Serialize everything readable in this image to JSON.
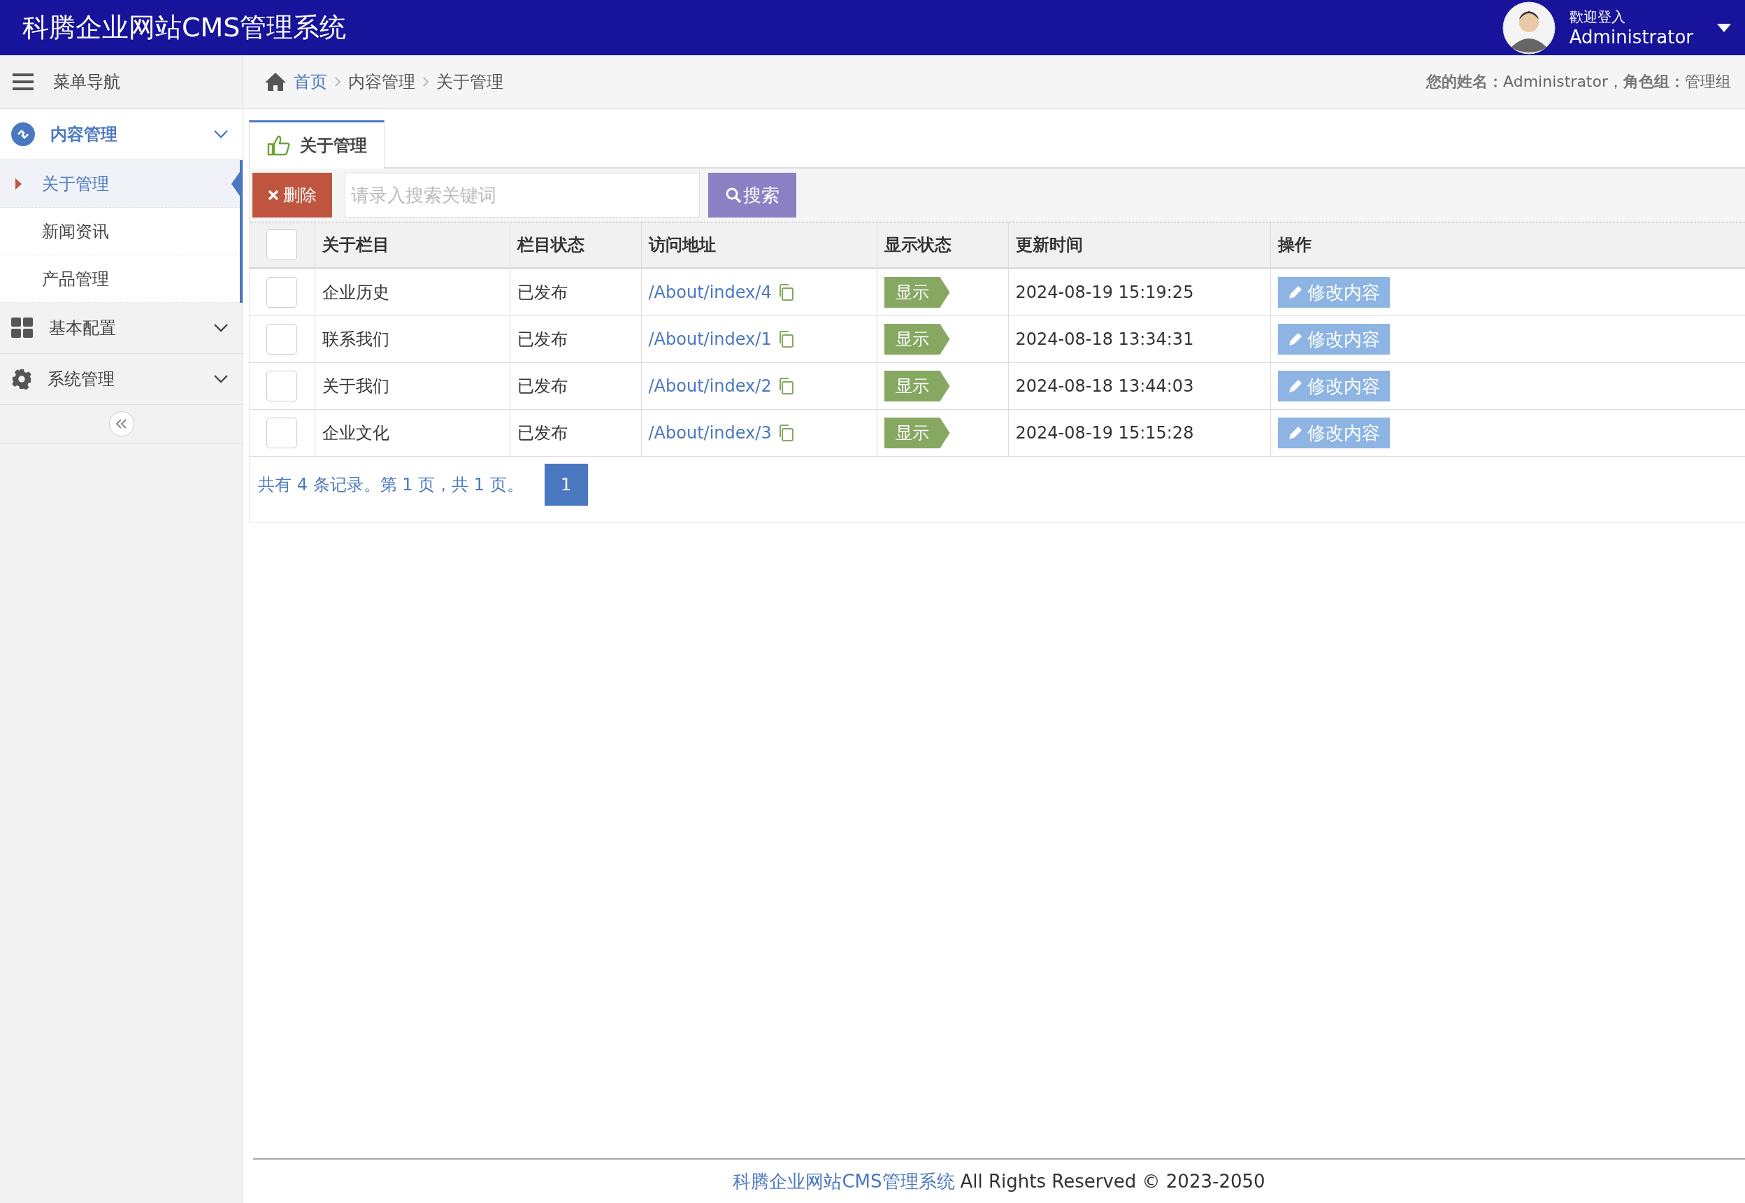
{
  "header": {
    "title": "科腾企业网站CMS管理系统",
    "user": {
      "greeting": "歡迎登入",
      "name": "Administrator"
    }
  },
  "sidebar": {
    "heading": "菜单导航",
    "groups": [
      {
        "label": "内容管理",
        "expanded": true,
        "children": [
          {
            "label": "关于管理",
            "selected": true
          },
          {
            "label": "新闻资讯",
            "selected": false
          },
          {
            "label": "产品管理",
            "selected": false
          }
        ]
      },
      {
        "label": "基本配置",
        "expanded": false
      },
      {
        "label": "系统管理",
        "expanded": false
      }
    ]
  },
  "breadcrumb": {
    "items": [
      "首页",
      "内容管理",
      "关于管理"
    ],
    "user_info": "**您的姓名：**Administrator，**角色组：**管理组"
  },
  "tab": {
    "label": "关于管理"
  },
  "toolbar": {
    "delete_button": "删除",
    "search": {
      "placeholder": "请录入搜索关键词"
    },
    "search_button": "搜索"
  },
  "table": {
    "columns": [
      "关于栏目",
      "栏目状态",
      "访问地址",
      "显示状态",
      "更新时间",
      "操作"
    ],
    "header_checked": false,
    "rows": [
      {
        "checked": false,
        "name": "企业历史",
        "status": "已发布",
        "url": "/About/index/4",
        "display": "显示",
        "updated": "2024-08-19 15:19:25",
        "action": "修改内容"
      },
      {
        "checked": false,
        "name": "联系我们",
        "status": "已发布",
        "url": "/About/index/1",
        "display": "显示",
        "updated": "2024-08-18 13:34:31",
        "action": "修改内容"
      },
      {
        "checked": false,
        "name": "关于我们",
        "status": "已发布",
        "url": "/About/index/2",
        "display": "显示",
        "updated": "2024-08-18 13:44:03",
        "action": "修改内容"
      },
      {
        "checked": false,
        "name": "企业文化",
        "status": "已发布",
        "url": "/About/index/3",
        "display": "显示",
        "updated": "2024-08-19 15:15:28",
        "action": "修改内容"
      }
    ]
  },
  "pager": {
    "summary": "共有 4 条记录。第 1 页，共 1 页。",
    "pages": [
      {
        "label": "1",
        "selected": true
      }
    ]
  },
  "footer": {
    "link": "科腾企业网站CMS管理系统",
    "text": "All Rights Reserved © 2023-2050"
  }
}
